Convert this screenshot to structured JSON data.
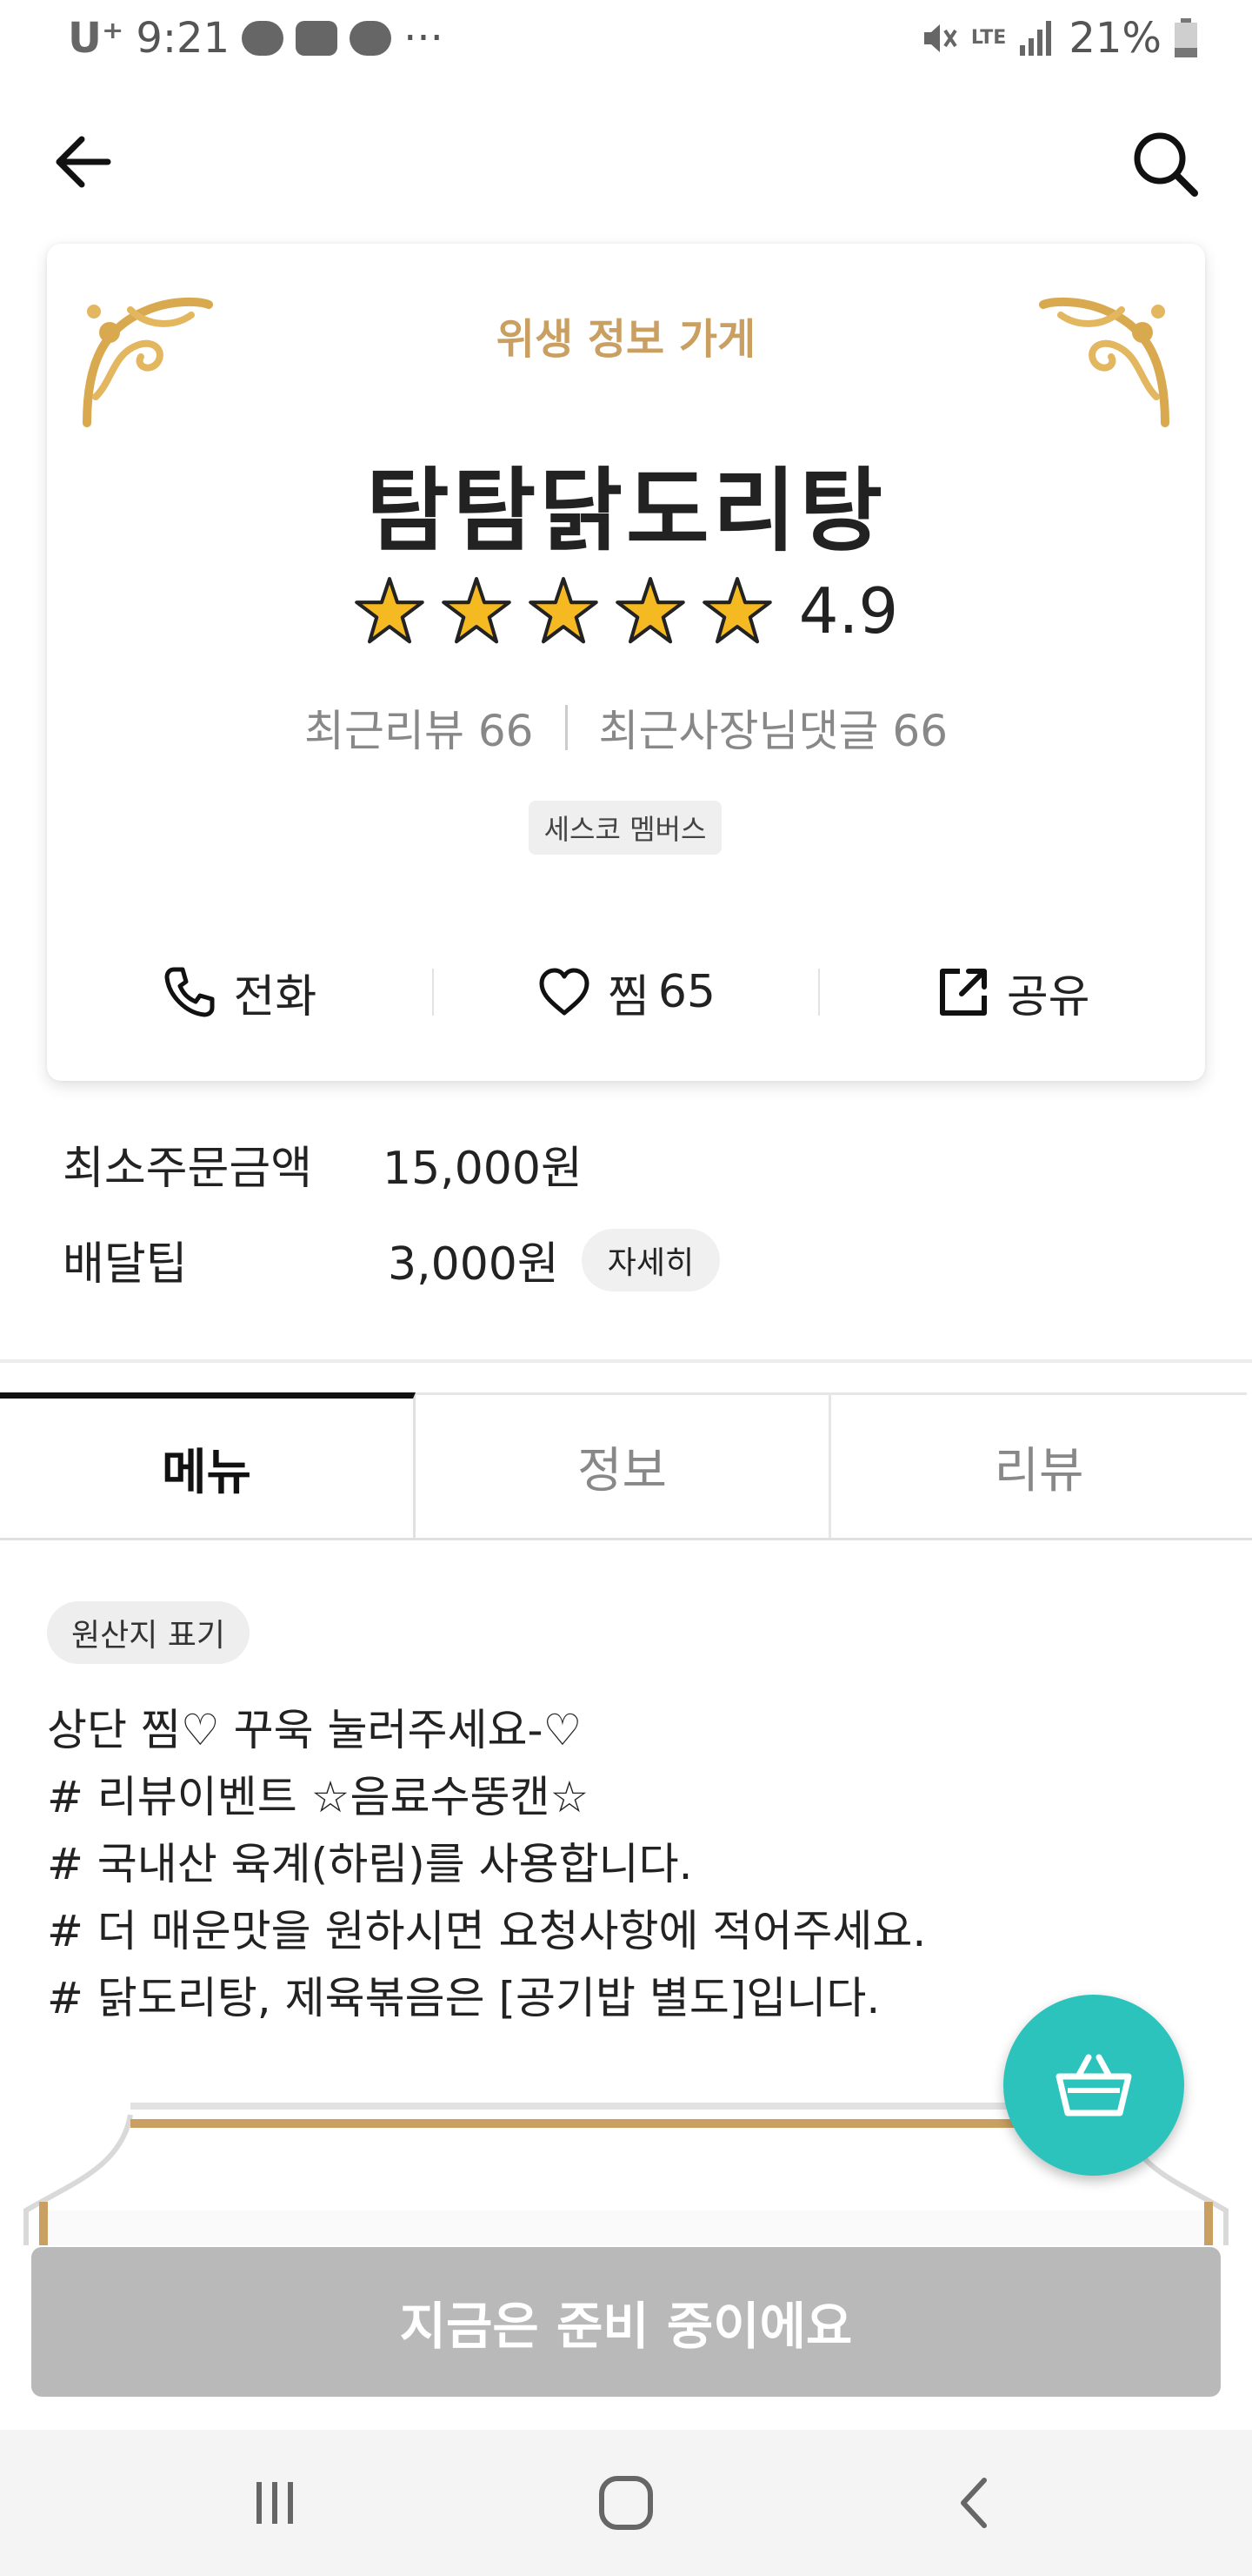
{
  "status_bar": {
    "carrier": "U⁺",
    "time": "9:21",
    "network": "LTE",
    "battery": "21%"
  },
  "store": {
    "hygiene_label": "위생 정보 가게",
    "name": "탐탐닭도리탕",
    "rating": "4.9",
    "stars": 5,
    "recent_reviews": "최근리뷰 66",
    "owner_replies": "최근사장님댓글 66",
    "badge": "세스코 멤버스",
    "actions": {
      "call": "전화",
      "like": "찜",
      "like_count": "65",
      "share": "공유"
    }
  },
  "order_info": {
    "min_order_label": "최소주문금액",
    "min_order_value": "15,000원",
    "delivery_tip_label": "배달팁",
    "delivery_tip_value": "3,000원",
    "detail_button": "자세히"
  },
  "tabs": [
    {
      "label": "메뉴",
      "active": true
    },
    {
      "label": "정보",
      "active": false
    },
    {
      "label": "리뷰",
      "active": false
    }
  ],
  "menu": {
    "origin_button": "원산지 표기",
    "notice_lines": [
      "상단 찜♡ 꾸욱 눌러주세요-♡",
      "# 리뷰이벤트 ☆음료수뚱캔☆",
      "# 국내산 육계(하림)를 사용합니다.",
      "# 더 매운맛을 원하시면 요청사항에 적어주세요.",
      "# 닭도리탕, 제육볶음은 [공기밥 별도]입니다."
    ]
  },
  "prepare_bar": "지금은 준비 중이에요",
  "colors": {
    "accent_gold": "#c9a062",
    "star": "#f5b921",
    "fab": "#2cc3bd",
    "disabled_bar": "#b9b9b9"
  },
  "icons": {
    "back": "arrow-left-icon",
    "search": "search-icon",
    "call": "phone-icon",
    "like": "heart-icon",
    "share": "share-icon",
    "cart": "basket-icon"
  }
}
